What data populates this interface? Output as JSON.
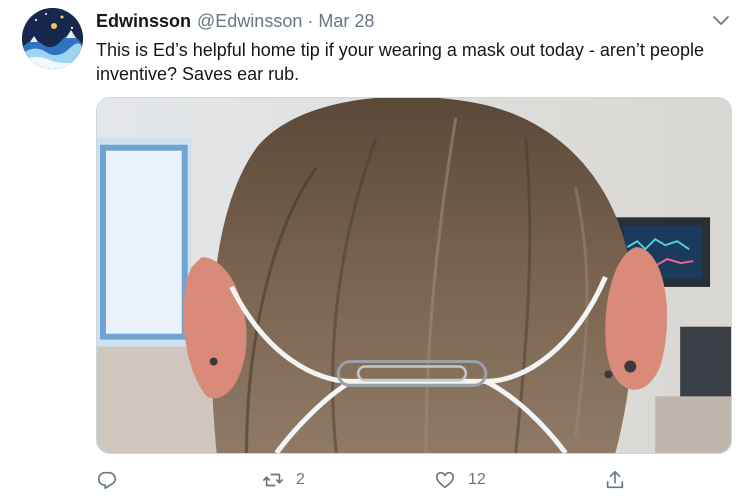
{
  "tweet": {
    "display_name": "Edwinsson",
    "handle": "@Edwinsson",
    "separator": "·",
    "date": "Mar 28",
    "text": "This is Ed’s helpful home tip if your wearing a mask out today - aren’t people inventive? Saves ear rub."
  },
  "actions": {
    "reply_count": "",
    "retweet_count": "2",
    "like_count": "12",
    "share_count": ""
  },
  "colors": {
    "text_primary": "#14171a",
    "text_secondary": "#657786",
    "border": "#ccd6dd"
  },
  "icons": [
    "avatar-image",
    "chevron-down-icon",
    "reply-icon",
    "retweet-icon",
    "like-icon",
    "share-icon"
  ]
}
